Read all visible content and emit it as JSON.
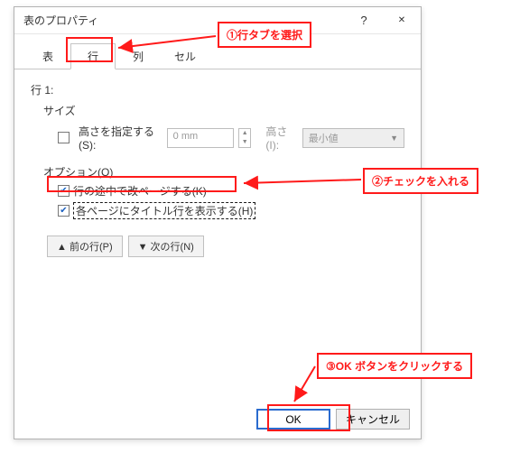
{
  "dialog": {
    "title": "表のプロパティ",
    "help_symbol": "?",
    "close_symbol": "✕"
  },
  "tabs": {
    "items": [
      "表",
      "行",
      "列",
      "セル"
    ],
    "active_index": 1
  },
  "body": {
    "row_label": "行 1:",
    "size_label": "サイズ",
    "specify_height": "高さを指定する(S):",
    "height_value": "0 mm",
    "height_mode_label": "高さ(I):",
    "height_mode_value": "最小値",
    "options_label": "オプション(O)",
    "allow_break": "行の途中で改ページする(K)",
    "repeat_header": "各ページにタイトル行を表示する(H)"
  },
  "nav": {
    "prev": "▲ 前の行(P)",
    "next": "▼ 次の行(N)"
  },
  "footer": {
    "ok": "OK",
    "cancel": "キャンセル"
  },
  "annotations": {
    "a1": "①行タブを選択",
    "a2": "②チェックを入れる",
    "a3": "③OK ボタンをクリックする"
  },
  "colors": {
    "annotation": "#ff1a1a",
    "accent": "#2a6bcf"
  }
}
